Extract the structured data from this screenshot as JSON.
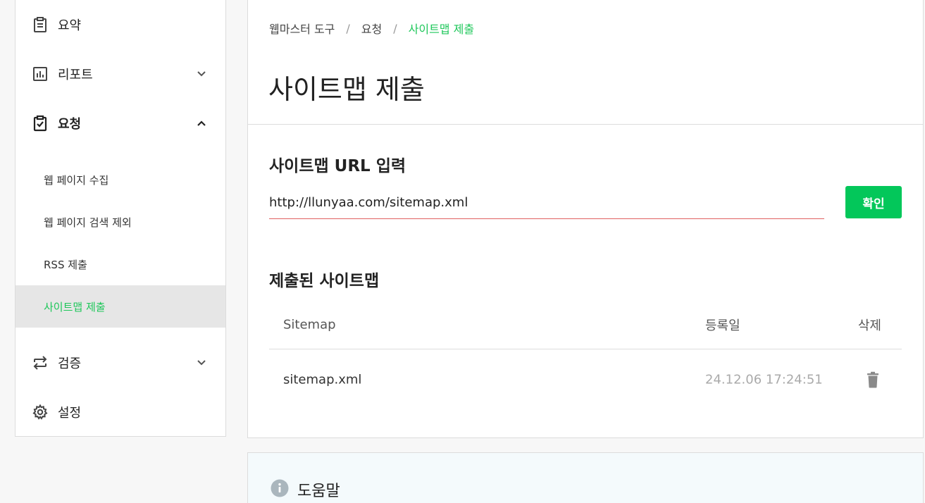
{
  "sidebar": {
    "items": [
      {
        "label": "요약",
        "icon": "clipboard-icon"
      },
      {
        "label": "리포트",
        "icon": "bar-chart-icon"
      },
      {
        "label": "요청",
        "icon": "clipboard-check-icon"
      },
      {
        "label": "검증",
        "icon": "swap-arrows-icon"
      },
      {
        "label": "설정",
        "icon": "gear-icon"
      }
    ],
    "subitems": [
      {
        "label": "웹 페이지 수집"
      },
      {
        "label": "웹 페이지 검색 제외"
      },
      {
        "label": "RSS 제출"
      },
      {
        "label": "사이트맵 제출"
      }
    ]
  },
  "breadcrumb": {
    "items": [
      "웹마스터 도구",
      "요청",
      "사이트맵 제출"
    ],
    "separator": "/"
  },
  "page_title": "사이트맵 제출",
  "url_section": {
    "title": "사이트맵 URL 입력",
    "value": "http://llunyaa.com/sitemap.xml",
    "confirm_label": "확인"
  },
  "submitted_section": {
    "title": "제출된 사이트맵",
    "headers": {
      "name": "Sitemap",
      "date": "등록일",
      "delete": "삭제"
    },
    "rows": [
      {
        "name": "sitemap.xml",
        "date": "24.12.06 17:24:51"
      }
    ]
  },
  "help": {
    "title": "도움말"
  },
  "colors": {
    "accent": "#03c75a",
    "active_text": "#1ec75a",
    "input_underline": "#e06060"
  }
}
